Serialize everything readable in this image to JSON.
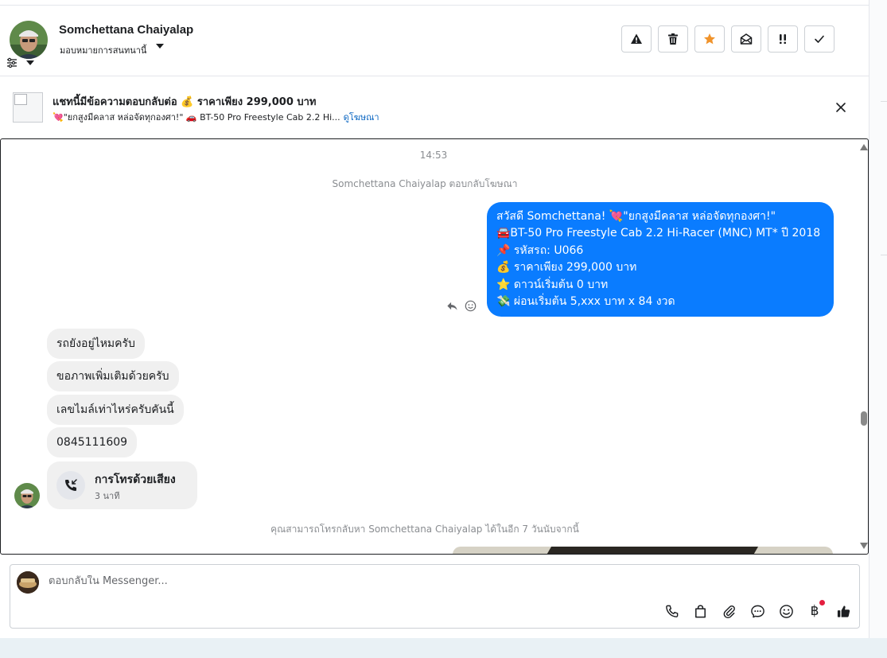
{
  "contact": {
    "name": "Somchettana Chaiyalap",
    "assign_label": "มอบหมายการสนทนานี้"
  },
  "header_actions": [
    {
      "name": "spam-button",
      "icon": "warning-icon"
    },
    {
      "name": "delete-button",
      "icon": "trash-icon"
    },
    {
      "name": "star-button",
      "icon": "star-icon",
      "color": "#f0932b"
    },
    {
      "name": "mark-unread-button",
      "icon": "envelope-open-icon"
    },
    {
      "name": "follow-up-button",
      "icon": "double-exclamation-icon"
    },
    {
      "name": "done-button",
      "icon": "check-icon"
    }
  ],
  "ad_banner": {
    "title": "แชทนี้มีข้อความตอบกลับต่อ 💰 ราคาเพียง 299,000 บาท",
    "subtitle": "💘\"ยกสูงมีคลาส หล่อจัดทุกองศา!\" 🚗 BT-50 Pro Freestyle Cab 2.2 Hi...",
    "link": "ดูโฆษณา"
  },
  "conversation": {
    "timestamp": "14:53",
    "system_reply": "Somchettana Chaiyalap ตอบกลับโฆษณา",
    "outgoing_lines": [
      "สวัสดี Somchettana! 💘\"ยกสูงมีคลาส หล่อจัดทุกองศา!\"",
      "🚘BT-50 Pro Freestyle Cab 2.2 Hi-Racer (MNC) MT* ปี 2018",
      "📌 รหัสรถ: U066",
      "💰 ราคาเพียง 299,000 บาท",
      "⭐ ดาวน์เริ่มต้น 0 บาท",
      "💸 ผ่อนเริ่มต้น 5,xxx บาท x 84 งวด"
    ],
    "incoming": [
      "รถยังอยู่ไหมครับ",
      "ขอภาพเพิ่มเติมด้วยครับ",
      "เลขไมล์เท่าไหร่ครับคันนี้",
      "0845111609"
    ],
    "call": {
      "title": "การโทรด้วยเสียง",
      "duration": "3 นาที"
    },
    "callback_notice": "คุณสามารถโทรกลับหา Somchettana Chaiyalap ได้ในอีก 7 วันนับจากนี้"
  },
  "composer": {
    "placeholder": "ตอบกลับใน Messenger...",
    "baht_symbol": "฿"
  },
  "colors": {
    "accent_blue": "#0a7cff",
    "link_blue": "#0a66c2",
    "star_orange": "#f0932b",
    "notification_red": "#e41e3f"
  }
}
